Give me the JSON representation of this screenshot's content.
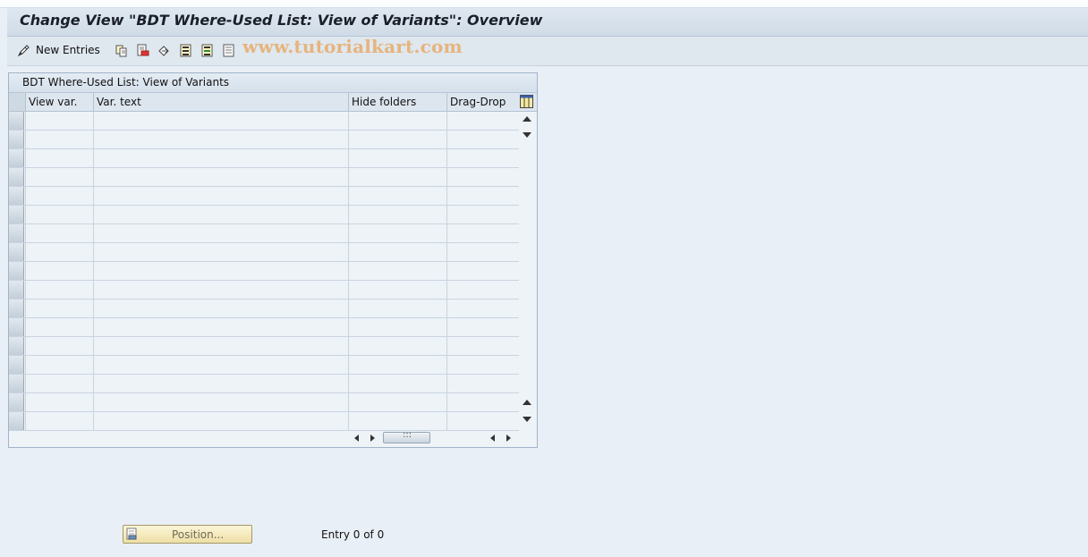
{
  "window": {
    "title": "Change View \"BDT Where-Used List: View of Variants\": Overview"
  },
  "toolbar": {
    "new_entries_label": "New Entries",
    "icons": [
      "change-display-icon",
      "copy-icon",
      "delete-icon",
      "undo-icon",
      "select-all-icon",
      "select-block-icon",
      "deselect-all-icon"
    ]
  },
  "watermark": "www.tutorialkart.com",
  "table": {
    "caption": "BDT Where-Used List: View of Variants",
    "columns": [
      "View var.",
      "Var. text",
      "Hide folders",
      "Drag-Drop"
    ],
    "rows": [
      [
        "",
        "",
        "",
        ""
      ],
      [
        "",
        "",
        "",
        ""
      ],
      [
        "",
        "",
        "",
        ""
      ],
      [
        "",
        "",
        "",
        ""
      ],
      [
        "",
        "",
        "",
        ""
      ],
      [
        "",
        "",
        "",
        ""
      ],
      [
        "",
        "",
        "",
        ""
      ],
      [
        "",
        "",
        "",
        ""
      ],
      [
        "",
        "",
        "",
        ""
      ],
      [
        "",
        "",
        "",
        ""
      ],
      [
        "",
        "",
        "",
        ""
      ],
      [
        "",
        "",
        "",
        ""
      ],
      [
        "",
        "",
        "",
        ""
      ],
      [
        "",
        "",
        "",
        ""
      ],
      [
        "",
        "",
        "",
        ""
      ],
      [
        "",
        "",
        "",
        ""
      ],
      [
        "",
        "",
        "",
        ""
      ]
    ]
  },
  "footer": {
    "position_button_label": "Position...",
    "entry_text": "Entry 0 of 0"
  }
}
